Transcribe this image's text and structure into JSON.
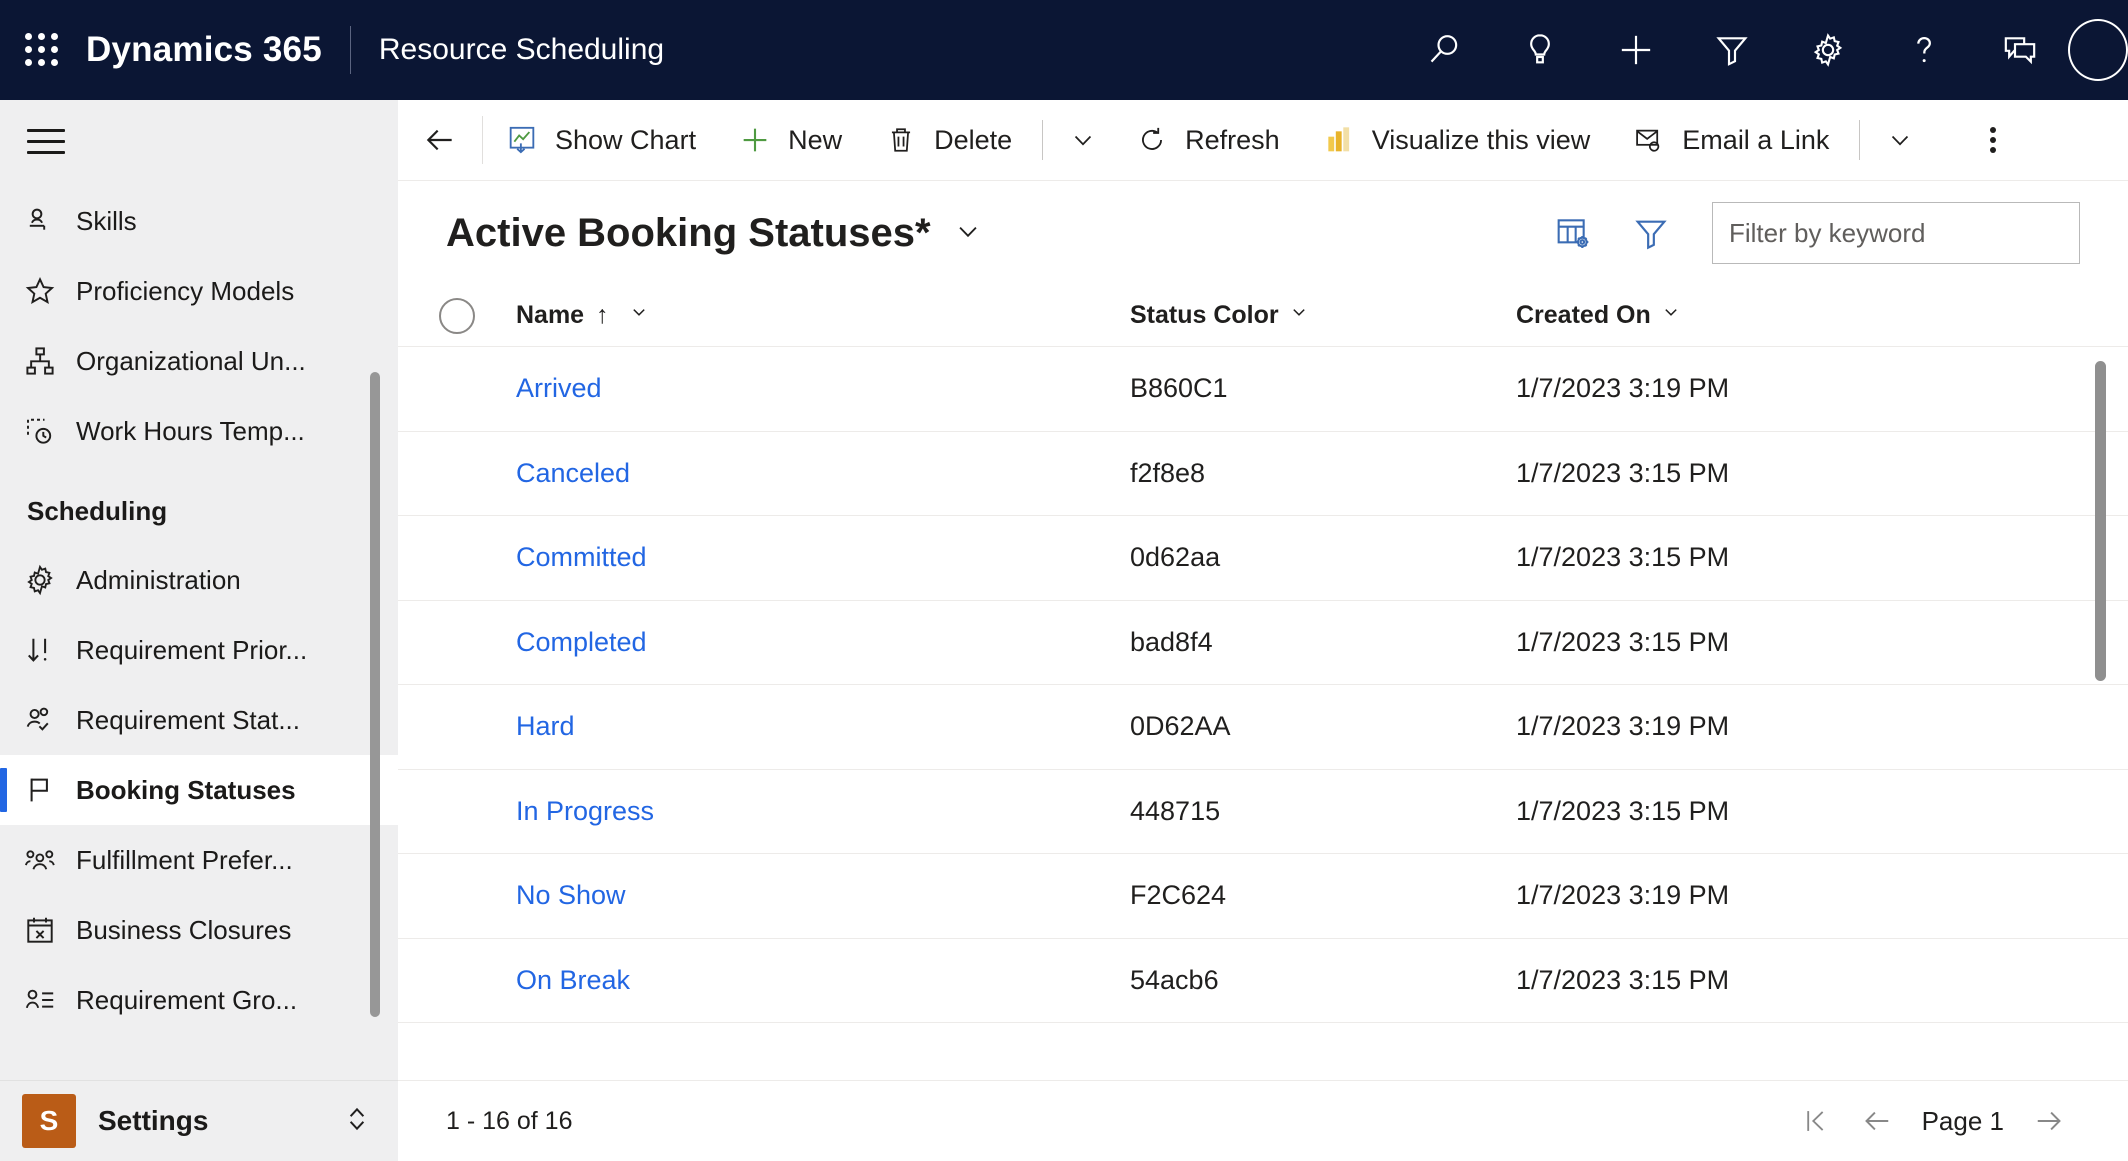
{
  "topbar": {
    "waffle_label": "app-launcher",
    "brand": "Dynamics 365",
    "app_name": "Resource Scheduling",
    "icons": [
      {
        "name": "search-icon",
        "label": "Search"
      },
      {
        "name": "lightbulb-icon",
        "label": "Insights"
      },
      {
        "name": "plus-icon",
        "label": "Quick create"
      },
      {
        "name": "filter-icon",
        "label": "Filter"
      },
      {
        "name": "gear-icon",
        "label": "Settings"
      },
      {
        "name": "question-icon",
        "label": "Help"
      },
      {
        "name": "feedback-icon",
        "label": "Feedback"
      }
    ]
  },
  "sidebar": {
    "hamburger_label": "Site map",
    "items": [
      {
        "label": "Skills",
        "icon": "skill-icon",
        "selected": false
      },
      {
        "label": "Proficiency Models",
        "icon": "star-icon",
        "selected": false
      },
      {
        "label": "Organizational Un...",
        "icon": "org-unit-icon",
        "selected": false
      },
      {
        "label": "Work Hours Temp...",
        "icon": "work-hours-icon",
        "selected": false
      }
    ],
    "group_label": "Scheduling",
    "group_items": [
      {
        "label": "Administration",
        "icon": "gear-icon",
        "selected": false
      },
      {
        "label": "Requirement Prior...",
        "icon": "priority-icon",
        "selected": false
      },
      {
        "label": "Requirement Stat...",
        "icon": "requirement-status-icon",
        "selected": false
      },
      {
        "label": "Booking Statuses",
        "icon": "flag-icon",
        "selected": true
      },
      {
        "label": "Fulfillment Prefer...",
        "icon": "fulfillment-icon",
        "selected": false
      },
      {
        "label": "Business Closures",
        "icon": "calendar-x-icon",
        "selected": false
      },
      {
        "label": "Requirement Gro...",
        "icon": "requirement-group-icon",
        "selected": false
      }
    ],
    "settings": {
      "badge": "S",
      "label": "Settings",
      "chevron": "up-down-chevron-icon"
    }
  },
  "commandbar": {
    "back_label": "Back",
    "buttons": [
      {
        "label": "Show Chart",
        "icon": "show-chart-icon"
      },
      {
        "label": "New",
        "icon": "plus-icon"
      },
      {
        "label": "Delete",
        "icon": "trash-icon"
      }
    ],
    "delete_overflow_chevron": "chevron-down-icon",
    "refresh": {
      "label": "Refresh",
      "icon": "refresh-icon"
    },
    "visualize": {
      "label": "Visualize this view",
      "icon": "powerbi-icon"
    },
    "email_link": {
      "label": "Email a Link",
      "icon": "email-link-icon"
    },
    "email_overflow_chevron": "chevron-down-icon",
    "more_label": "More commands"
  },
  "view": {
    "title": "Active Booking Statuses*",
    "title_chevron": "chevron-down-icon",
    "edit_columns_label": "Edit columns",
    "edit_filters_label": "Edit filters",
    "search": {
      "placeholder": "Filter by keyword",
      "value": ""
    }
  },
  "grid": {
    "select_all_label": "Select all rows",
    "columns": [
      {
        "label": "Name",
        "sort": "↑",
        "chevron": "chevron-down-icon"
      },
      {
        "label": "Status Color",
        "sort": "",
        "chevron": "chevron-down-icon"
      },
      {
        "label": "Created On",
        "sort": "",
        "chevron": "chevron-down-icon"
      }
    ],
    "rows": [
      {
        "name": "Arrived",
        "status_color": "B860C1",
        "created_on": "1/7/2023 3:19 PM"
      },
      {
        "name": "Canceled",
        "status_color": "f2f8e8",
        "created_on": "1/7/2023 3:15 PM"
      },
      {
        "name": "Committed",
        "status_color": "0d62aa",
        "created_on": "1/7/2023 3:15 PM"
      },
      {
        "name": "Completed",
        "status_color": "bad8f4",
        "created_on": "1/7/2023 3:15 PM"
      },
      {
        "name": "Hard",
        "status_color": "0D62AA",
        "created_on": "1/7/2023 3:19 PM"
      },
      {
        "name": "In Progress",
        "status_color": "448715",
        "created_on": "1/7/2023 3:15 PM"
      },
      {
        "name": "No Show",
        "status_color": "F2C624",
        "created_on": "1/7/2023 3:19 PM"
      },
      {
        "name": "On Break",
        "status_color": "54acb6",
        "created_on": "1/7/2023 3:15 PM"
      }
    ]
  },
  "footer": {
    "count": "1 - 16 of 16",
    "first_page_label": "First page",
    "prev_page_label": "Previous page",
    "page_label": "Page 1",
    "next_page_label": "Next page"
  },
  "colors": {
    "topbar_bg": "#0b1634",
    "accent_link": "#2266e3",
    "sidebar_bg": "#efeff0",
    "settings_badge": "#ba5c17",
    "icon_blue": "#3b6cb4",
    "new_green": "#4f9a41",
    "powerbi_yellow": "#e8b32a"
  }
}
